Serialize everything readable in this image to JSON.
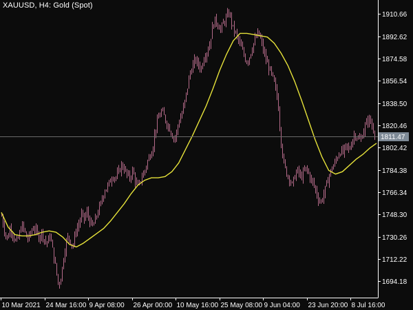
{
  "header": {
    "symbol_line": "XAUUSD, H4:  Gold (Spot)"
  },
  "price_marker": {
    "label": "1811.47",
    "value": 1811.47
  },
  "colors": {
    "background": "#0c0c0c",
    "axis_line": "#ffffff",
    "axis_text": "#ffffff",
    "candle": "#b56b8a",
    "moving_average": "#e6e23a",
    "price_line": "#6b6b6b",
    "price_tag_bg": "#7e8a96",
    "price_tag_text": "#ffffff"
  },
  "chart_data": {
    "type": "line",
    "title": "XAUUSD, H4:  Gold (Spot)",
    "xlabel": "",
    "ylabel": "",
    "ylim": [
      1681,
      1922
    ],
    "grid": false,
    "y_ticks": [
      1910.66,
      1892.62,
      1874.58,
      1856.54,
      1838.5,
      1820.46,
      1802.42,
      1784.38,
      1766.34,
      1748.3,
      1730.26,
      1712.22,
      1694.18
    ],
    "y_tick_labels": [
      "1910.66",
      "1892.62",
      "1874.58",
      "1856.54",
      "1838.50",
      "1820.46",
      "1802.42",
      "1784.38",
      "1766.34",
      "1748.30",
      "1730.26",
      "1712.22",
      "1694.18"
    ],
    "x_tick_labels": [
      "10 Mar 2021",
      "24 Mar 16:00",
      "9 Apr 08:00",
      "26 Apr 00:00",
      "10 May 16:00",
      "25 May 08:00",
      "9 Jun 04:00",
      "23 Jun 20:00",
      "8 Jul 16:00"
    ],
    "series": [
      {
        "kind": "price",
        "values": [
          1747,
          1735,
          1728,
          1738,
          1732,
          1725,
          1730,
          1740,
          1735,
          1728,
          1732,
          1738,
          1735,
          1730,
          1734,
          1728,
          1725,
          1732,
          1718,
          1705,
          1690,
          1700,
          1718,
          1730,
          1728,
          1722,
          1735,
          1740,
          1748,
          1745,
          1750,
          1742,
          1738,
          1745,
          1752,
          1758,
          1768,
          1770,
          1775,
          1780,
          1778,
          1782,
          1788,
          1786,
          1780,
          1778,
          1784,
          1775,
          1770,
          1778,
          1782,
          1790,
          1796,
          1802,
          1818,
          1826,
          1832,
          1828,
          1822,
          1818,
          1812,
          1810,
          1822,
          1828,
          1836,
          1848,
          1862,
          1868,
          1874,
          1870,
          1866,
          1876,
          1880,
          1886,
          1900,
          1906,
          1902,
          1898,
          1904,
          1908,
          1912,
          1900,
          1896,
          1890,
          1884,
          1878,
          1872,
          1876,
          1884,
          1890,
          1895,
          1890,
          1880,
          1872,
          1866,
          1860,
          1852,
          1840,
          1810,
          1790,
          1782,
          1778,
          1772,
          1780,
          1784,
          1778,
          1782,
          1786,
          1780,
          1775,
          1770,
          1762,
          1758,
          1764,
          1772,
          1780,
          1786,
          1790,
          1796,
          1800,
          1798,
          1804,
          1800,
          1808,
          1814,
          1810,
          1808,
          1816,
          1822,
          1826,
          1820,
          1815
        ]
      },
      {
        "kind": "moving-average",
        "values": [
          1750,
          1738,
          1732,
          1731,
          1731,
          1732,
          1734,
          1735,
          1734,
          1730,
          1724,
          1722,
          1725,
          1729,
          1733,
          1737,
          1743,
          1750,
          1757,
          1765,
          1772,
          1776,
          1778,
          1778,
          1779,
          1783,
          1790,
          1801,
          1812,
          1824,
          1836,
          1850,
          1865,
          1878,
          1889,
          1895,
          1895,
          1894,
          1893,
          1892,
          1887,
          1879,
          1869,
          1856,
          1841,
          1825,
          1809,
          1795,
          1784,
          1781,
          1783,
          1788,
          1793,
          1797,
          1802,
          1806
        ]
      }
    ]
  }
}
